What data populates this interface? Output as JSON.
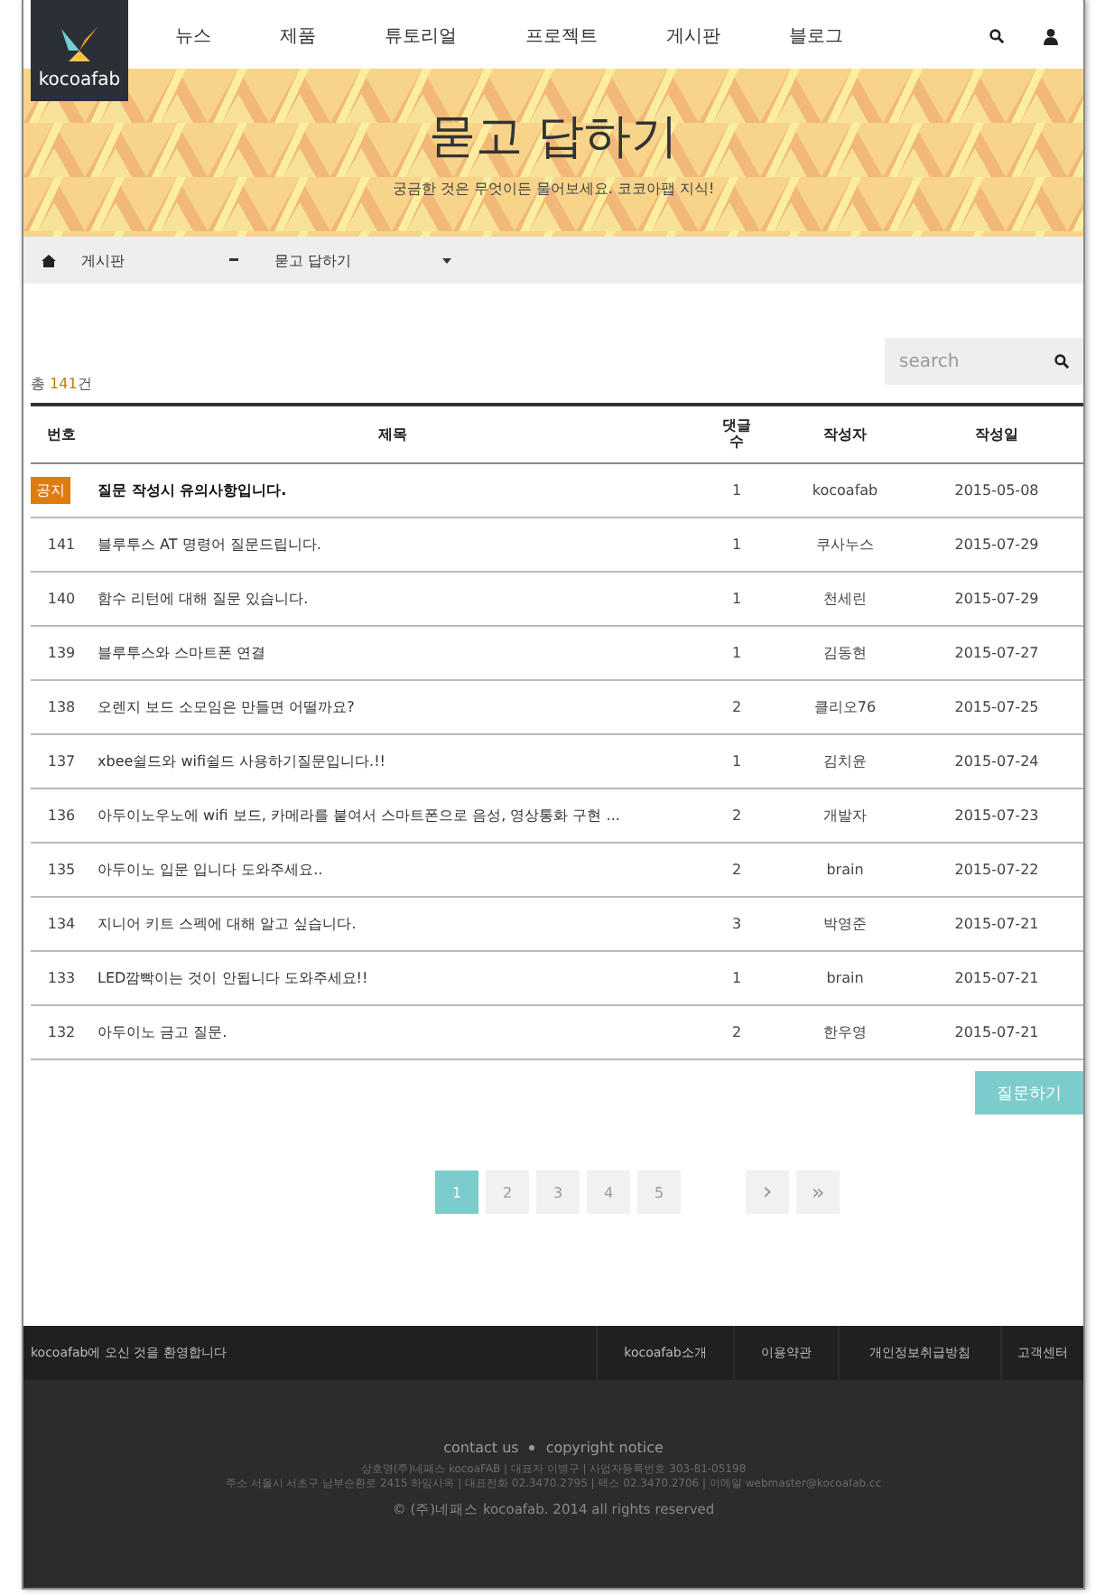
{
  "nav": {
    "logo": "kocoafab",
    "items": [
      "뉴스",
      "제품",
      "튜토리얼",
      "프로젝트",
      "게시판",
      "블로그"
    ]
  },
  "banner": {
    "title": "묻고 답하기",
    "subtitle": "궁금한 것은 무엇이든 물어보세요. 코코아팹 지식!"
  },
  "breadcrumb": [
    "게시판",
    "묻고 답하기"
  ],
  "search": {
    "placeholder": "search"
  },
  "count": {
    "prefix": "총 ",
    "number": "141",
    "suffix": "건"
  },
  "table": {
    "columns": [
      "번호",
      "제목",
      "댓글 수",
      "작성자",
      "작성일"
    ],
    "rows": [
      {
        "kind": "notice",
        "number": "공지",
        "title": "질문 작성시 유의사항입니다.",
        "comments": "1",
        "author": "kocoafab",
        "date": "2015-05-08"
      },
      {
        "kind": "post",
        "number": "141",
        "title": "블루투스 AT 명령어 질문드립니다.",
        "comments": "1",
        "author": "쿠사누스",
        "date": "2015-07-29"
      },
      {
        "kind": "post",
        "number": "140",
        "title": "함수 리턴에 대해 질문 있습니다.",
        "comments": "1",
        "author": "천세린",
        "date": "2015-07-29"
      },
      {
        "kind": "post",
        "number": "139",
        "title": "블루투스와 스마트폰 연결",
        "comments": "1",
        "author": "김동현",
        "date": "2015-07-27"
      },
      {
        "kind": "post",
        "number": "138",
        "title": "오렌지 보드 소모임은 만들면 어떨까요?",
        "comments": "2",
        "author": "클리오76",
        "date": "2015-07-25"
      },
      {
        "kind": "post",
        "number": "137",
        "title": "xbee쉴드와 wifi쉴드 사용하기질문입니다.!!",
        "comments": "1",
        "author": "김치윤",
        "date": "2015-07-24"
      },
      {
        "kind": "post",
        "number": "136",
        "title": "아두이노우노에 wifi 보드, 카메라를 붙여서 스마트폰으로 음성, 영상통화 구현 ...",
        "comments": "2",
        "author": "개발자",
        "date": "2015-07-23"
      },
      {
        "kind": "post",
        "number": "135",
        "title": "아두이노 입문 입니다 도와주세요..",
        "comments": "2",
        "author": "brain",
        "date": "2015-07-22"
      },
      {
        "kind": "post",
        "number": "134",
        "title": "지니어 키트 스펙에 대해 알고 싶습니다.",
        "comments": "3",
        "author": "박영준",
        "date": "2015-07-21"
      },
      {
        "kind": "post",
        "number": "133",
        "title": "LED깜빡이는 것이 안됩니다 도와주세요!!",
        "comments": "1",
        "author": "brain",
        "date": "2015-07-21"
      },
      {
        "kind": "post",
        "number": "132",
        "title": "아두이노 금고 질문.",
        "comments": "2",
        "author": "한우영",
        "date": "2015-07-21"
      }
    ]
  },
  "ask_button": "질문하기",
  "pagination": {
    "pages": [
      {
        "label": "1",
        "selected": true
      },
      {
        "label": "2",
        "selected": false
      },
      {
        "label": "3",
        "selected": false
      },
      {
        "label": "4",
        "selected": false
      },
      {
        "label": "5",
        "selected": false
      }
    ],
    "next": "›",
    "last": "»"
  },
  "footer": {
    "welcome": "kocoafab에 오신 것을 환영합니다",
    "links": [
      "kocoafab소개",
      "이용약관",
      "개인정보취급방침",
      "고객센터"
    ],
    "contact": "contact us",
    "copyright_notice": "copyright notice",
    "company_lines": [
      "상호명(주)네패스 kocoaFAB | 대표자 이병구 | 사업자등록번호 303-81-05198",
      "주소 서울시 서초구 남부순환로 2415 하임사옥 | 대표전화 02.3470.2795 | 팩스 02.3470.2706 | 이메일 webmaster@kocoafab.cc"
    ],
    "copyright": "© (주)네패스 kocoafab. 2014 all rights reserved"
  }
}
